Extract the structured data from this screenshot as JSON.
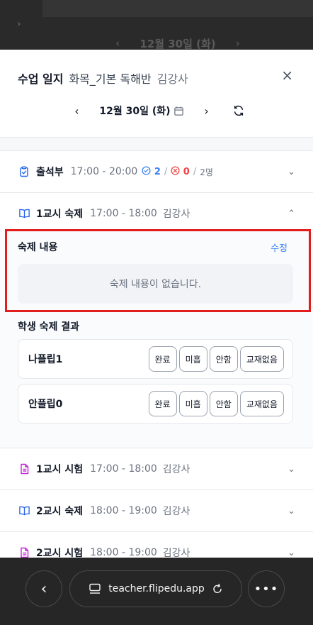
{
  "background": {
    "chevron": "›",
    "prev": "‹",
    "date": "12월 30일 (화)",
    "next": "›"
  },
  "header": {
    "title": "수업 일지",
    "class_name": "화목_기본 독해반",
    "teacher": "김강사",
    "close": "×"
  },
  "date_nav": {
    "prev": "‹",
    "date": "12월 30일 (화)",
    "next": "›"
  },
  "attendance": {
    "label": "출석부",
    "time": "17:00 - 20:00",
    "present": "2",
    "sep": "/",
    "absent": "0",
    "total": "2명",
    "chevron": "⌄"
  },
  "homework": {
    "label": "1교시 숙제",
    "time": "17:00 - 18:00",
    "teacher": "김강사",
    "chevron": "⌃",
    "content_title": "숙제 내용",
    "edit_label": "수정",
    "empty_text": "숙제 내용이 없습니다.",
    "results_title": "학생 숙제 결과",
    "students": [
      {
        "name": "나플립1",
        "options": [
          "완료",
          "미흡",
          "안함",
          "교재없음"
        ]
      },
      {
        "name": "안플립0",
        "options": [
          "완료",
          "미흡",
          "안함",
          "교재없음"
        ]
      }
    ]
  },
  "sessions": [
    {
      "label": "1교시 시험",
      "time": "17:00 - 18:00",
      "teacher": "김강사",
      "type": "exam",
      "chevron": "⌄"
    },
    {
      "label": "2교시 숙제",
      "time": "18:00 - 19:00",
      "teacher": "김강사",
      "type": "homework",
      "chevron": "⌄"
    },
    {
      "label": "2교시 시험",
      "time": "18:00 - 19:00",
      "teacher": "김강사",
      "type": "exam",
      "chevron": "⌄"
    }
  ],
  "browser": {
    "back": "‹",
    "url": "teacher.flipedu.app",
    "more": "•••"
  },
  "colors": {
    "accent": "#3b82f6",
    "danger": "#ef4444",
    "exam_icon": "#c026d3",
    "homework_icon": "#2563eb",
    "highlight_frame": "#e11d1d"
  }
}
